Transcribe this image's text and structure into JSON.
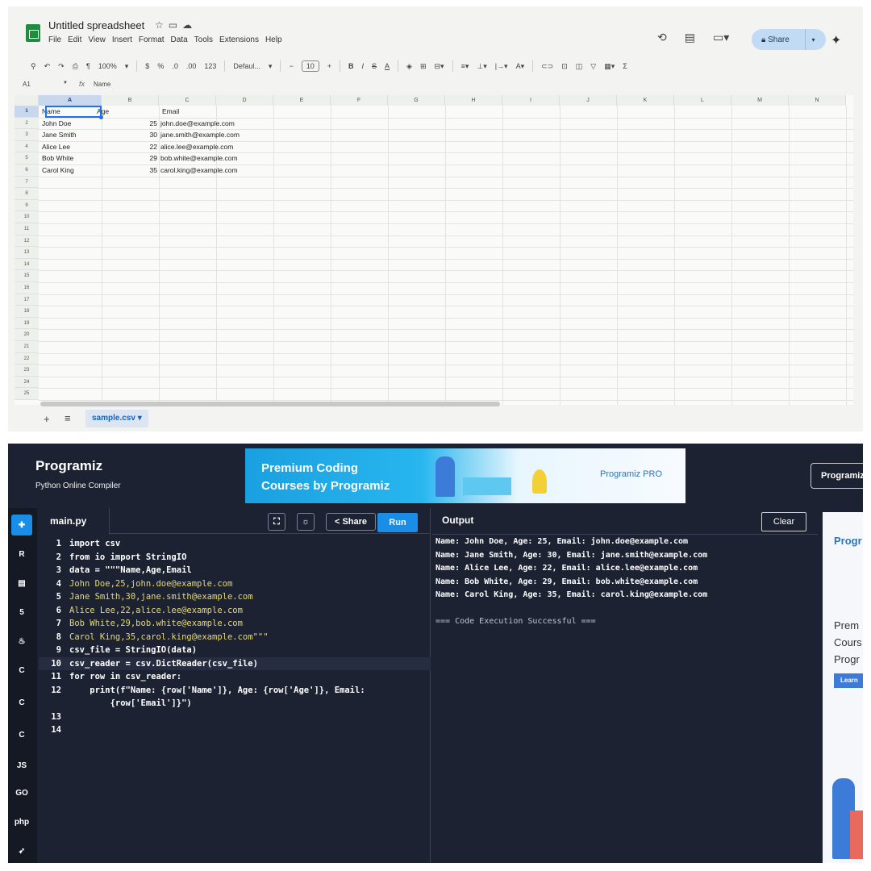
{
  "sheets": {
    "doc_title": "Untitled spreadsheet",
    "menu": [
      "File",
      "Edit",
      "View",
      "Insert",
      "Format",
      "Data",
      "Tools",
      "Extensions",
      "Help"
    ],
    "share_label": "Share",
    "toolbar": {
      "zoom": "100%",
      "currency": "$",
      "percent": "%",
      "dec_decrease": ".0",
      "dec_increase": ".00",
      "format_123": "123",
      "font": "Defaul...",
      "font_size": "10"
    },
    "formula_bar": {
      "cell_ref": "A1",
      "fx": "fx",
      "value": "Name"
    },
    "columns": [
      "A",
      "B",
      "C",
      "D",
      "E",
      "F",
      "G",
      "H",
      "I",
      "J",
      "K",
      "L",
      "M",
      "N"
    ],
    "row_numbers": [
      "1",
      "2",
      "3",
      "4",
      "5",
      "6",
      "7",
      "8",
      "9",
      "10",
      "11",
      "12",
      "13",
      "14",
      "15",
      "16",
      "17",
      "18",
      "19",
      "20",
      "21",
      "22",
      "23",
      "24",
      "25"
    ],
    "header_row": {
      "a": "Name",
      "b": "Age",
      "c": "Email"
    },
    "rows": [
      {
        "name": "John Doe",
        "age": "25",
        "email": "john.doe@example.com"
      },
      {
        "name": "Jane Smith",
        "age": "30",
        "email": "jane.smith@example.com"
      },
      {
        "name": "Alice Lee",
        "age": "22",
        "email": "alice.lee@example.com"
      },
      {
        "name": "Bob White",
        "age": "29",
        "email": "bob.white@example.com"
      },
      {
        "name": "Carol King",
        "age": "35",
        "email": "carol.king@example.com"
      }
    ],
    "sheet_tab": "sample.csv"
  },
  "programiz": {
    "logo": "Programiz",
    "subtitle": "Python Online Compiler",
    "banner_line1": "Premium Coding",
    "banner_line2": "Courses by Programiz",
    "banner_logo": "Programiz PRO",
    "top_button": "Programiz",
    "file_tab": "main.py",
    "share_label": "Share",
    "run_label": "Run",
    "output_title": "Output",
    "clear_label": "Clear",
    "sidebar_langs": [
      "python",
      "R",
      "sql",
      "html5",
      "java",
      "C",
      "C++",
      "C#",
      "JS",
      "GO",
      "php",
      "swift"
    ],
    "code_lines": [
      "import csv",
      "from io import StringIO",
      "data = \"\"\"Name,Age,Email",
      "John Doe,25,john.doe@example.com",
      "Jane Smith,30,jane.smith@example.com",
      "Alice Lee,22,alice.lee@example.com",
      "Bob White,29,bob.white@example.com",
      "Carol King,35,carol.king@example.com\"\"\"",
      "csv_file = StringIO(data)",
      "csv_reader = csv.DictReader(csv_file)",
      "for row in csv_reader:",
      "    print(f\"Name: {row['Name']}, Age: {row['Age']}, Email:",
      "        {row['Email']}\")",
      "",
      ""
    ],
    "line_numbers": [
      "1",
      "2",
      "3",
      "4",
      "5",
      "6",
      "7",
      "8",
      "9",
      "10",
      "11",
      "12",
      "",
      "13",
      "14"
    ],
    "output_lines": [
      "Name: John Doe, Age: 25, Email: john.doe@example.com",
      "Name: Jane Smith, Age: 30, Email: jane.smith@example.com",
      "Name: Alice Lee, Age: 22, Email: alice.lee@example.com",
      "Name: Bob White, Age: 29, Email: bob.white@example.com",
      "Name: Carol King, Age: 35, Email: carol.king@example.com"
    ],
    "output_status": "=== Code Execution Successful ===",
    "ad_logo": "Progr",
    "ad_text": [
      "Prem",
      "Cours",
      "Progr"
    ],
    "ad_button": "Learn"
  }
}
